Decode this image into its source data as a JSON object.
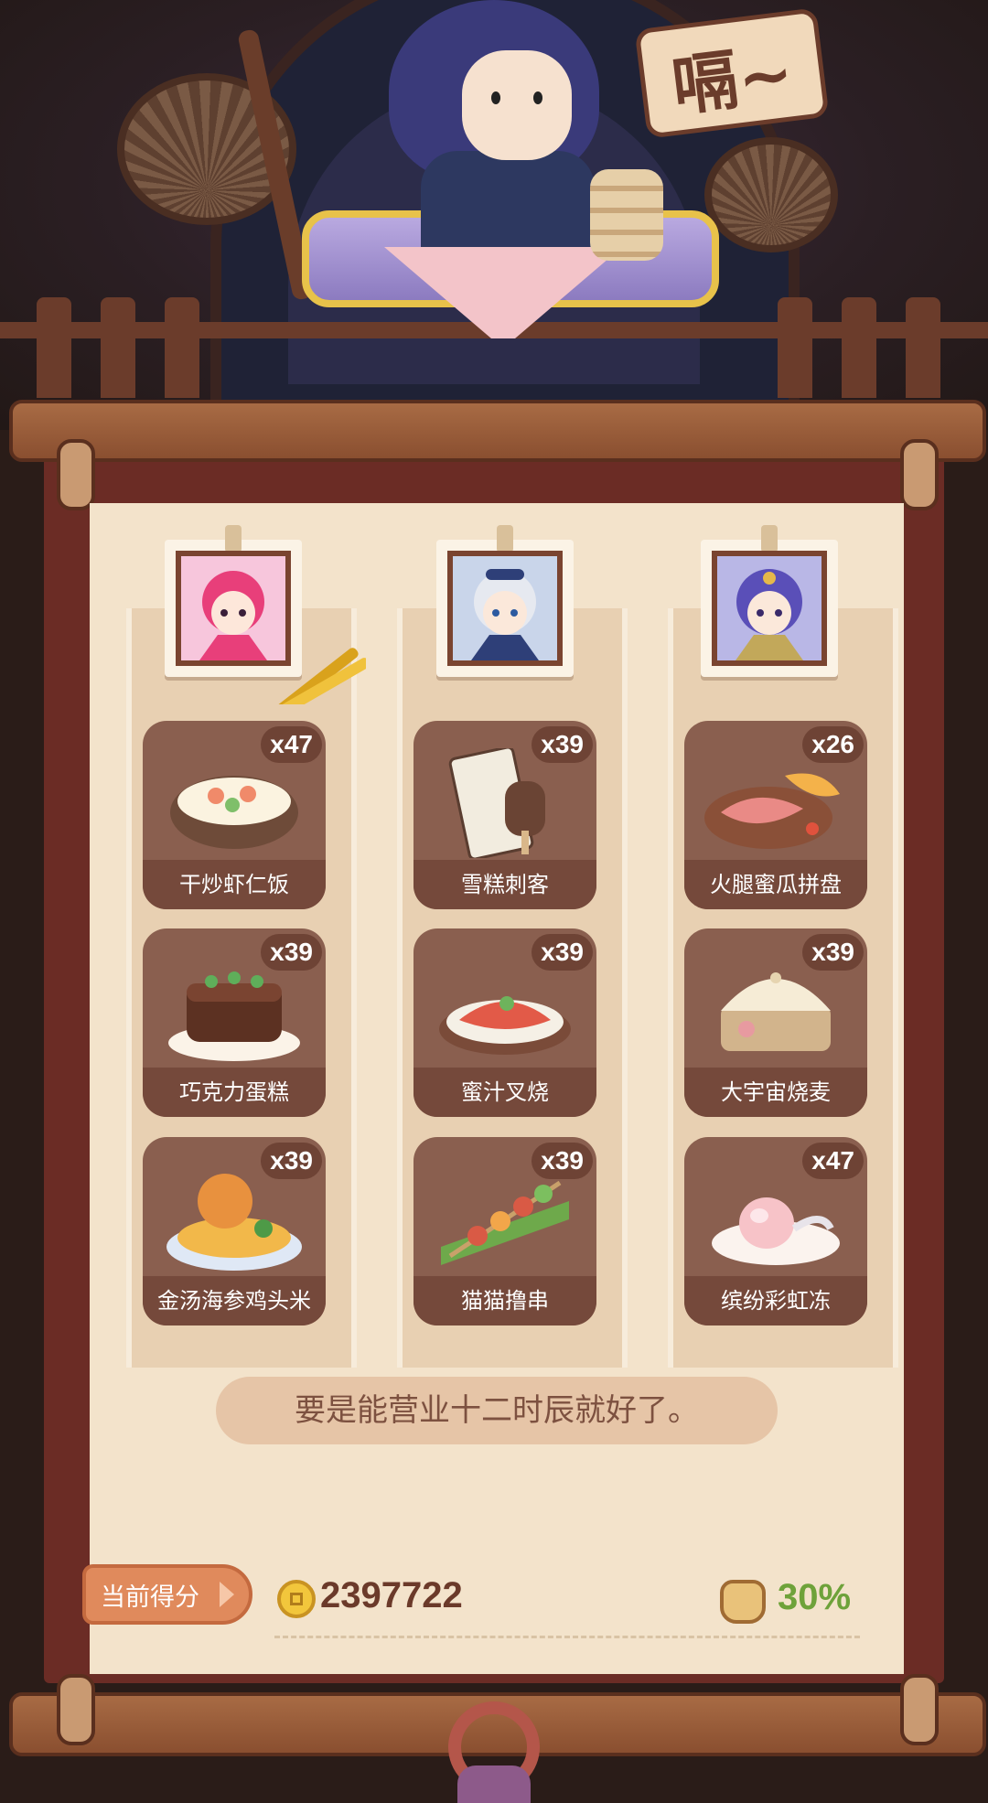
{
  "header": {
    "speech_sign": "嗝~"
  },
  "colors": {
    "paper": "#f3e3cb",
    "scroll_frame": "#6b2c25",
    "card": "#8a5f4f",
    "card_label": "#75493b",
    "bonus_green": "#6ea23a",
    "score_brown": "#6b3a2a"
  },
  "columns": [
    {
      "portrait_icon": "pink-hair-character-portrait",
      "dishes": [
        {
          "name": "干炒虾仁饭",
          "count": "x47",
          "icon": "shrimp-fried-rice"
        },
        {
          "name": "巧克力蛋糕",
          "count": "x39",
          "icon": "chocolate-cake"
        },
        {
          "name": "金汤海参鸡头米",
          "count": "x39",
          "icon": "golden-soup-sea-cucumber"
        }
      ]
    },
    {
      "portrait_icon": "silver-hair-character-portrait",
      "dishes": [
        {
          "name": "雪糕刺客",
          "count": "x39",
          "icon": "ice-cream-assassin"
        },
        {
          "name": "蜜汁叉烧",
          "count": "x39",
          "icon": "honey-char-siu"
        },
        {
          "name": "猫猫撸串",
          "count": "x39",
          "icon": "cat-skewers"
        }
      ]
    },
    {
      "portrait_icon": "purple-hair-character-portrait",
      "dishes": [
        {
          "name": "火腿蜜瓜拼盘",
          "count": "x26",
          "icon": "ham-melon-platter"
        },
        {
          "name": "大宇宙烧麦",
          "count": "x39",
          "icon": "big-universe-shumai"
        },
        {
          "name": "缤纷彩虹冻",
          "count": "x47",
          "icon": "rainbow-jelly"
        }
      ]
    }
  ],
  "message": "要是能营业十二时辰就好了。",
  "score": {
    "label": "当前得分",
    "value": "2397722",
    "bonus": "30%"
  }
}
